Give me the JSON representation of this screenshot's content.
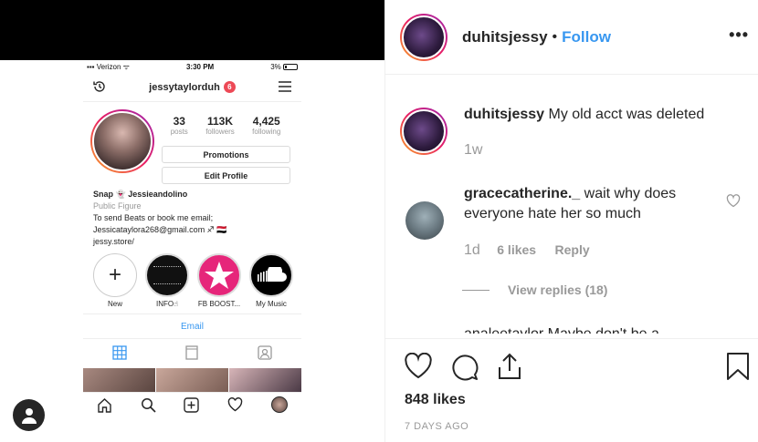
{
  "phone": {
    "carrier": "Verizon",
    "time": "3:30 PM",
    "battery": "3%",
    "username": "jessytaylorduh",
    "notif_count": "6",
    "stats": [
      {
        "num": "33",
        "label": "posts"
      },
      {
        "num": "113K",
        "label": "followers"
      },
      {
        "num": "4,425",
        "label": "following"
      }
    ],
    "promotions_label": "Promotions",
    "edit_profile_label": "Edit Profile",
    "bio": {
      "snap": "Snap 👻 Jessieandolino",
      "category": "Public Figure",
      "line1": "To send Beats or book me email;",
      "line2": "Jessicataylora268@gmail.com ♐ 🇾🇪",
      "link": "jessy.store/"
    },
    "highlights": [
      {
        "label": "New"
      },
      {
        "label": "INFO☝"
      },
      {
        "label": "FB BOOST..."
      },
      {
        "label": "My Music"
      }
    ],
    "email_button": "Email"
  },
  "post": {
    "author": "duhitsjessy",
    "follow": "Follow",
    "caption": "My old acct was deleted",
    "caption_time": "1w",
    "comment": {
      "user": "gracecatherine._",
      "text_line1": "wait why does",
      "text_line2": "everyone hate her so much",
      "time": "1d",
      "likes": "6 likes",
      "reply": "Reply",
      "view_replies": "View replies (18)"
    },
    "cut_comment": "analeetaylor Maybe don't be a",
    "likes": "848 likes",
    "date": "7 DAYS AGO"
  },
  "colors": {
    "link_blue": "#3897f0",
    "muted": "#999999",
    "text": "#262626"
  }
}
